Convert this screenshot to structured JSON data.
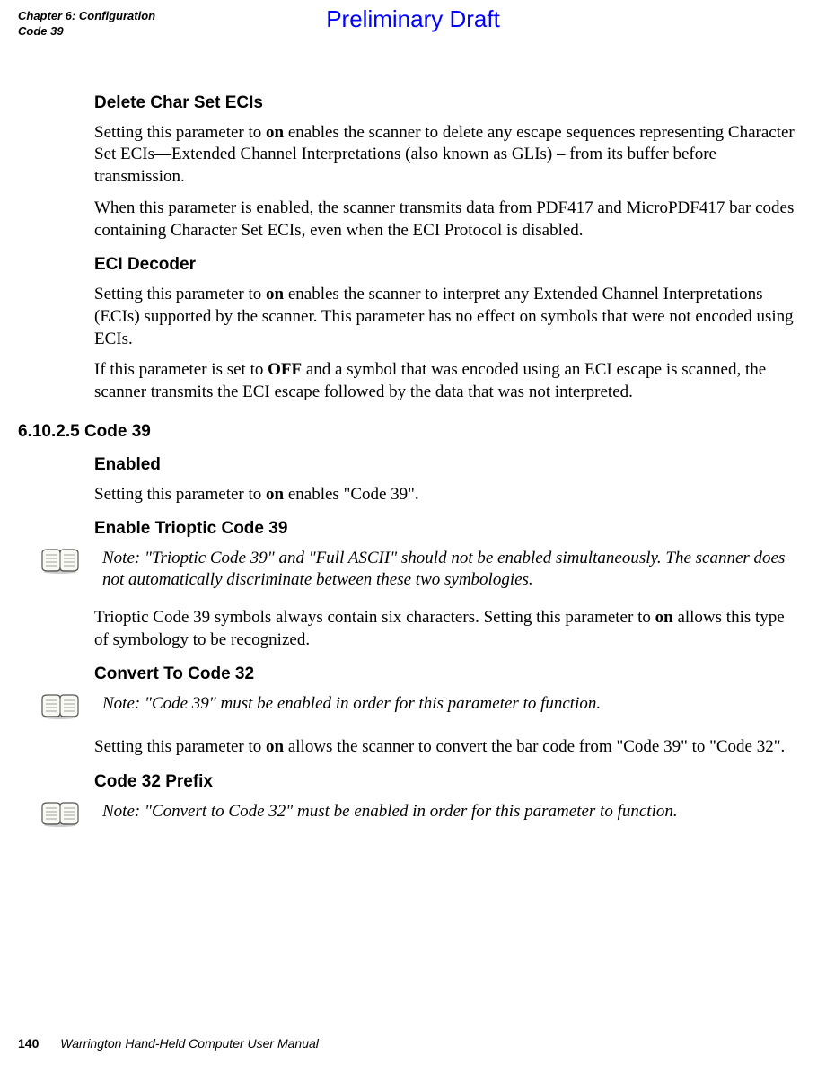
{
  "header": {
    "chapter": "Chapter 6: Configuration",
    "section": "Code 39",
    "watermark": "Preliminary Draft"
  },
  "s1": {
    "title": "Delete Char Set ECIs",
    "p1a": "Setting this parameter to ",
    "p1b": "on",
    "p1c": " enables the scanner to delete any escape sequences representing Character Set ECIs—Extended Channel Interpretations (also known as GLIs) – from its buffer before transmission.",
    "p2": "When this parameter is enabled, the scanner transmits data from PDF417 and MicroPDF417 bar codes containing Character Set ECIs, even when the ECI Protocol is disabled."
  },
  "s2": {
    "title": "ECI Decoder",
    "p1a": "Setting this parameter to ",
    "p1b": "on",
    "p1c": " enables the scanner to interpret any Extended Channel Interpretations (ECIs) supported by the scanner. This parameter has no effect on symbols that were not encoded using ECIs.",
    "p2a": "If this parameter is set to ",
    "p2b": "OFF",
    "p2c": " and a symbol that was encoded using an ECI escape is scanned, the scanner transmits the ECI escape followed by the data that was not interpreted."
  },
  "s3": {
    "number": "6.10.2.5 Code 39",
    "h1": "Enabled",
    "p1a": "Setting this parameter to ",
    "p1b": "on",
    "p1c": " enables \"Code 39\".",
    "h2": "Enable Trioptic Code 39",
    "note1": "Note: \"Trioptic Code 39\" and \"Full ASCII\" should not be enabled simultaneously. The scanner does not automatically discriminate between these two symbologies.",
    "p2a": "Trioptic Code 39 symbols always contain six characters. Setting this parameter to ",
    "p2b": "on",
    "p2c": " allows this type of symbology to be recognized.",
    "h3": "Convert To Code 32",
    "note2": "Note: \"Code 39\" must be enabled in order for this parameter to function.",
    "p3a": "Setting this parameter to ",
    "p3b": "on",
    "p3c": " allows the scanner to convert the bar code from \"Code 39\" to \"Code 32\".",
    "h4": "Code 32 Prefix",
    "note3": "Note: \"Convert to Code 32\" must be enabled in order for this parameter to function."
  },
  "footer": {
    "page": "140",
    "title": "Warrington Hand-Held Computer User Manual"
  }
}
